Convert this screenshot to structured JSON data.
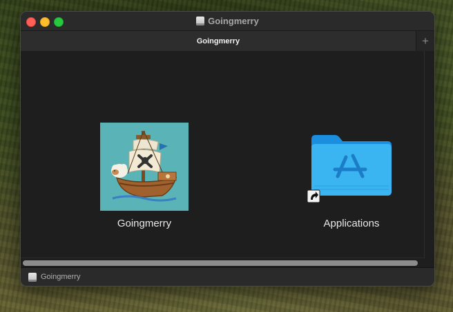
{
  "window": {
    "title": "Goingmerry"
  },
  "tabs": [
    {
      "label": "Goingmerry",
      "active": true
    }
  ],
  "new_tab_label": "+",
  "items": [
    {
      "label": "Goingmerry",
      "icon": "ship-app-icon"
    },
    {
      "label": "Applications",
      "icon": "applications-folder-icon"
    }
  ],
  "statusbar": {
    "path_label": "Goingmerry",
    "icon": "disk-image-icon"
  },
  "colors": {
    "close": "#fe5f57",
    "minimize": "#febc2e",
    "maximize": "#28c840",
    "folder": "#3bb0f0",
    "app_icon_bg": "#5ab3b6"
  }
}
